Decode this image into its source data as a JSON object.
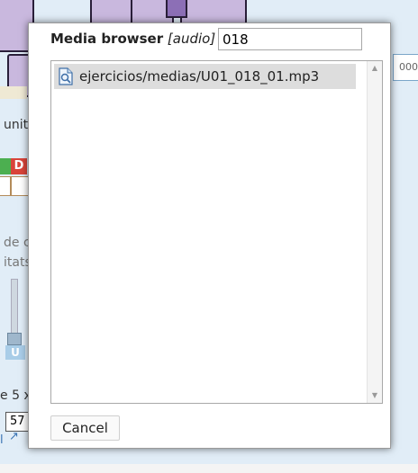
{
  "background": {
    "caption_fragment": "unit",
    "badge_letter": "D",
    "right_box_text": "000",
    "text_fragment_1": "de c",
    "text_fragment_2": "itats",
    "slider_badge": "U",
    "formula_fragment": "e 5 x",
    "number_field_value": "57",
    "link_fragment": "l"
  },
  "dialog": {
    "title_prefix": "Media browser",
    "title_type": "[audio]",
    "filter_value": "018",
    "files": [
      {
        "name": "ejercicios/medias/U01_018_01.mp3",
        "icon": "audio-file-icon",
        "selected": true
      }
    ],
    "cancel_label": "Cancel"
  }
}
